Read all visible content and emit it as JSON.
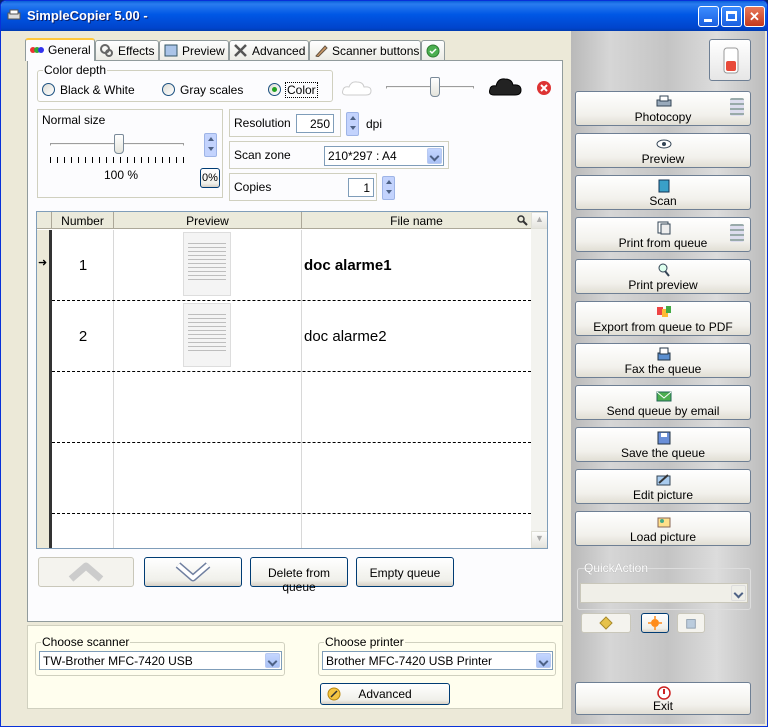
{
  "window": {
    "title": "SimpleCopier 5.00 -"
  },
  "tabs": [
    {
      "label": "General",
      "icon": "palette-icon"
    },
    {
      "label": "Effects",
      "icon": "effects-icon"
    },
    {
      "label": "Preview",
      "icon": "preview-icon"
    },
    {
      "label": "Advanced",
      "icon": "tools-icon"
    },
    {
      "label": "Scanner buttons",
      "icon": "pen-icon"
    }
  ],
  "color_depth": {
    "legend": "Color depth",
    "options": [
      "Black & White",
      "Gray scales",
      "Color"
    ],
    "selected": "Color",
    "density": 0.7
  },
  "normal_size": {
    "legend": "Normal size",
    "value": "100 %",
    "reset_label": "0%",
    "level": 0.5
  },
  "resolution": {
    "label": "Resolution",
    "value": "250",
    "unit": "dpi"
  },
  "scan_zone": {
    "label": "Scan zone",
    "value": "210*297 : A4"
  },
  "copies": {
    "label": "Copies",
    "value": "1"
  },
  "queue": {
    "columns": [
      "Number",
      "Preview",
      "File name"
    ],
    "rows": [
      {
        "number": "1",
        "file_name": "doc alarme1",
        "selected": true
      },
      {
        "number": "2",
        "file_name": "doc alarme2",
        "selected": false
      }
    ]
  },
  "queue_buttons": {
    "delete": "Delete from queue",
    "empty": "Empty queue"
  },
  "scanner": {
    "legend": "Choose scanner",
    "value": "TW-Brother MFC-7420 USB"
  },
  "printer": {
    "legend": "Choose printer",
    "value": "Brother MFC-7420 USB Printer"
  },
  "advanced_button": "Advanced",
  "actions": [
    {
      "label": "Photocopy",
      "icon": "printer-icon"
    },
    {
      "label": "Preview",
      "icon": "eye-icon"
    },
    {
      "label": "Scan",
      "icon": "scanner-icon"
    },
    {
      "label": "Print from queue",
      "icon": "print-queue-icon"
    },
    {
      "label": "Print preview",
      "icon": "magnifier-icon"
    },
    {
      "label": "Export from queue to PDF",
      "icon": "pdf-icon"
    },
    {
      "label": "Fax the queue",
      "icon": "fax-icon"
    },
    {
      "label": "Send queue by email",
      "icon": "email-icon"
    },
    {
      "label": "Save the queue",
      "icon": "floppy-icon"
    },
    {
      "label": "Edit picture",
      "icon": "edit-icon"
    },
    {
      "label": "Load picture",
      "icon": "load-icon"
    }
  ],
  "quick_action": {
    "legend": "QuickAction"
  },
  "exit_label": "Exit",
  "colors": {
    "title_bar": "#0054e3",
    "accent": "#ffc83c",
    "panel": "#fcfcfe"
  }
}
